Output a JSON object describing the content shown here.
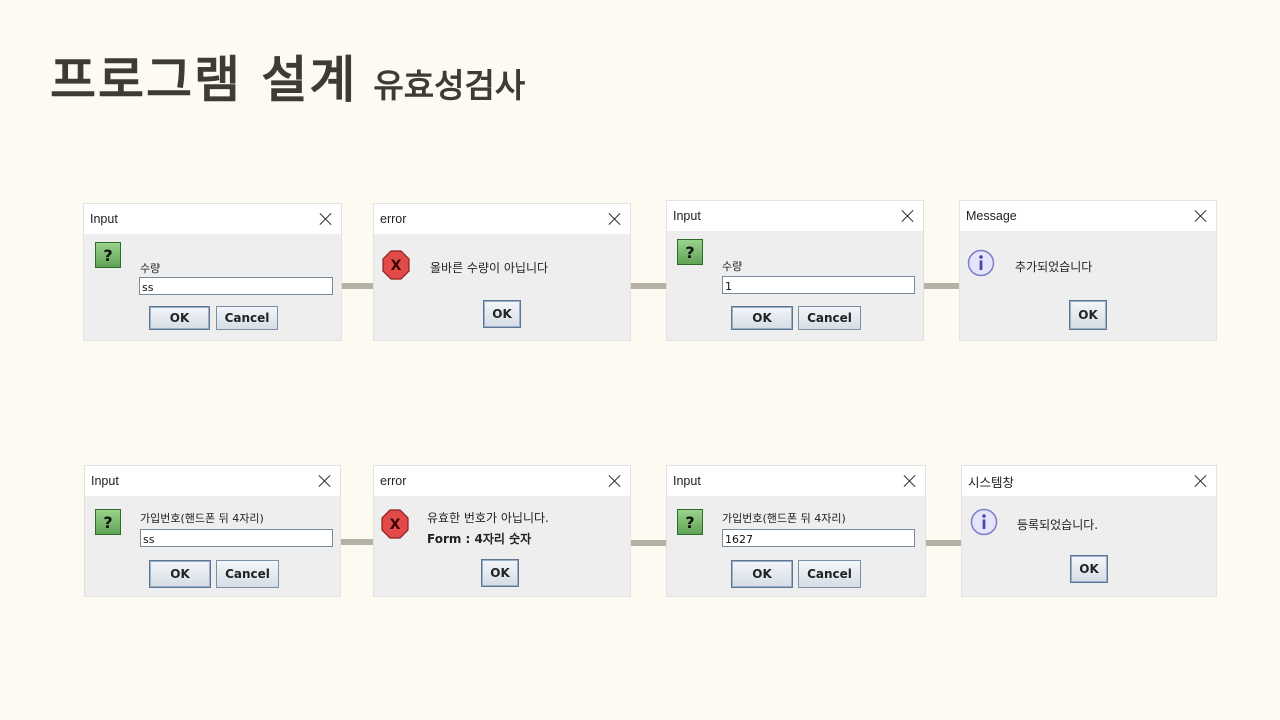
{
  "header": {
    "title_main": "프로그램 설계",
    "title_sub": "유효성검사"
  },
  "row1": {
    "d1": {
      "window_title": "Input",
      "label": "수량",
      "value": "ss",
      "ok": "OK",
      "cancel": "Cancel"
    },
    "d2": {
      "window_title": "error",
      "message": "올바른 수량이 아닙니다",
      "ok": "OK"
    },
    "d3": {
      "window_title": "Input",
      "label": "수량",
      "value": "1",
      "ok": "OK",
      "cancel": "Cancel"
    },
    "d4": {
      "window_title": "Message",
      "message": "추가되었습니다",
      "ok": "OK"
    }
  },
  "row2": {
    "d1": {
      "window_title": "Input",
      "label": "가입번호(핸드폰 뒤 4자리)",
      "value": "ss",
      "ok": "OK",
      "cancel": "Cancel"
    },
    "d2": {
      "window_title": "error",
      "message_line1": "유효한 번호가 아닙니다.",
      "message_line2": "Form : 4자리 숫자",
      "ok": "OK"
    },
    "d3": {
      "window_title": "Input",
      "label": "가입번호(핸드폰 뒤 4자리)",
      "value": "1627",
      "ok": "OK",
      "cancel": "Cancel"
    },
    "d4": {
      "window_title": "시스템창",
      "message": "등록되었습니다.",
      "ok": "OK"
    }
  },
  "icons": {
    "question": "question-icon",
    "error": "error-icon",
    "info": "info-icon"
  },
  "colors": {
    "background": "#fdfaf1",
    "title": "#3f3b33",
    "connector": "#b5b1a4",
    "dialog_body": "#eeeeee"
  }
}
